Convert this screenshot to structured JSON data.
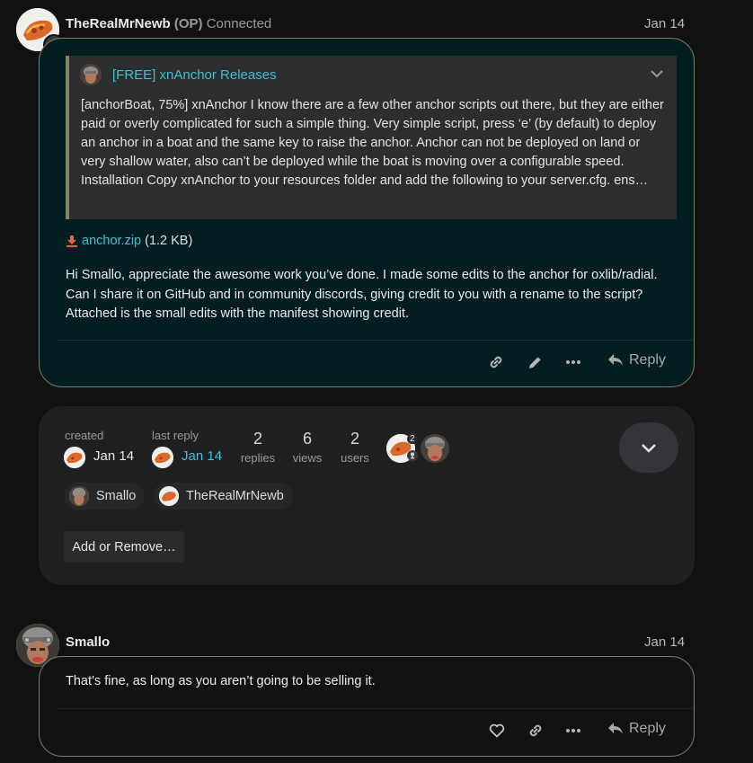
{
  "post1": {
    "username": "TheRealMrNewb",
    "op_tag": "(OP)",
    "status": "Connected",
    "date": "Jan 14",
    "quote": {
      "title": "[FREE] xnAnchor Releases",
      "text": "[anchorBoat, 75%] xnAnchor I know there are a few other anchor scripts out there, but they are either paid or overly complicated for such a simple thing. Very simple script, press ‘e’ (by default) to deploy an anchor in a boat and the same key to raise the anchor. Anchor can not be deployed on land or very shallow water, also can’t be deployed while the boat is moving over a configurable speed. Installation Copy xnAnchor to your resources folder and add the following to your server.cfg. ens…"
    },
    "attachment": {
      "name": "anchor.zip",
      "size": "(1.2 KB)"
    },
    "body": "Hi Smallo, appreciate the awesome work you’ve done. I made some edits to the anchor for oxlib/radial. Can I share it on GitHub and in community discords, giving credit to you with a rename to the script? Attached is the small edits with the manifest showing credit.",
    "actions": {
      "reply_label": "Reply"
    },
    "icons": [
      "link-icon",
      "pencil-icon",
      "more-icon",
      "reply-icon"
    ]
  },
  "summary": {
    "created_label": "created",
    "created_date": "Jan 14",
    "last_reply_label": "last reply",
    "last_reply_date": "Jan 14",
    "replies_num": "2",
    "replies_label": "replies",
    "views_num": "6",
    "views_label": "views",
    "users_num": "2",
    "users_label": "users",
    "participant_badge": "2",
    "chips": [
      {
        "name": "Smallo"
      },
      {
        "name": "TheRealMrNewb"
      }
    ],
    "add_remove_label": "Add or Remove…"
  },
  "post2": {
    "username": "Smallo",
    "date": "Jan 14",
    "body": "That’s fine, as long as you aren’t going to be selling it.",
    "actions": {
      "reply_label": "Reply"
    },
    "icons": [
      "heart-icon",
      "link-icon",
      "more-icon",
      "reply-icon"
    ]
  },
  "colors": {
    "background": "#111111",
    "accent": "#3ec1d3",
    "post_bg": "#021e21",
    "summary_bg": "#1f2022",
    "download_icon": "#e8643a"
  }
}
